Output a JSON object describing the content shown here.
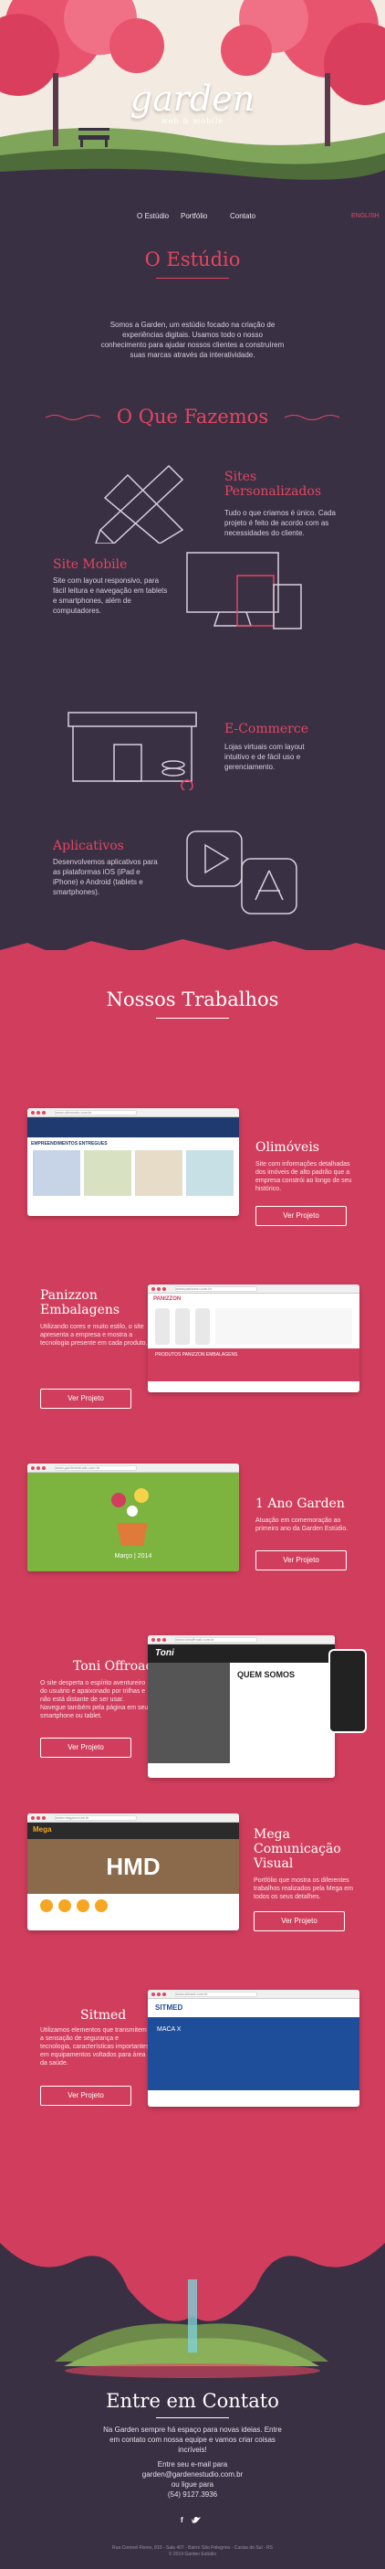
{
  "hero": {
    "logo": "garden",
    "tagline": "web & mobile"
  },
  "nav": {
    "items": [
      "O Estúdio",
      "Portfólio",
      "Contato"
    ],
    "lang": "ENGLISH"
  },
  "studio": {
    "title": "O Estúdio",
    "text": "Somos a Garden, um estúdio focado na criação de experiências digitais. Usamos todo o nosso conhecimento para ajudar nossos clientes a construírem suas marcas através da interatividade."
  },
  "services": {
    "title": "O Que Fazemos",
    "items": [
      {
        "title": "Sites Personalizados",
        "text": "Tudo o que criamos é único. Cada projeto é feito de acordo com as necessidades do cliente."
      },
      {
        "title": "Site Mobile",
        "text": "Site com layout responsivo, para fácil leitura e navegação em tablets e smartphones, além de computadores."
      },
      {
        "title": "E-Commerce",
        "text": "Lojas virtuais com layout intuitivo e de fácil uso e gerenciamento."
      },
      {
        "title": "Aplicativos",
        "text": "Desenvolvemos aplicativos para as plataformas iOS (iPad e iPhone) e Android (tablets e smartphones)."
      }
    ]
  },
  "works": {
    "title": "Nossos Trabalhos",
    "button_label": "Ver Projeto",
    "projects": [
      {
        "title": "Olimóveis",
        "text": "Site com informações detalhadas dos imóveis de alto padrão que a empresa constrói ao longo de seu histórico.",
        "url": "www.olimoveis.com.br"
      },
      {
        "title": "Panizzon Embalagens",
        "text": "Utilizando cores e muito estilo, o site apresenta a empresa e mostra a tecnologia presente em cada produto.",
        "url": "www.panizzon.com.br"
      },
      {
        "title": "1 Ano Garden",
        "text": "Atuação em comemoração ao primeiro ano da Garden Estúdio.",
        "url": "www.gardenestudio.com.br"
      },
      {
        "title": "Toni Offroad",
        "text": "O site desperta o espírito aventureiro do usuário e apaixonado por trilhas e não está distante de ser usar. Navegue também pela página em seu smartphone ou tablet.",
        "url": "www.tonioffroad.com.br"
      },
      {
        "title": "Mega Comunicação Visual",
        "text": "Portfólio que mostra os diferentes trabalhos realizados pela Mega em todos os seus detalhes.",
        "url": "www.megacv.com.br"
      },
      {
        "title": "Sitmed",
        "text": "Utilizamos elementos que transmitem a sensação de segurança e tecnologia, características importantes em equipamentos voltados para área da saúde.",
        "url": "www.sitmed.com.br"
      }
    ],
    "mock": {
      "olimoveis_heading": "EMPREENDIMENTOS ENTREGUES",
      "panizzon_brand": "PANIZZON",
      "panizzon_sub": "PRODUTOS PANIZZON EMBALAGENS",
      "garden_date": "Março | 2014",
      "toni_brand": "Toni",
      "toni_heading": "QUEM SOMOS",
      "mega_brand": "Mega",
      "mega_sign": "HMD",
      "sitmed_brand": "SITMED",
      "sitmed_product": "MACA X"
    }
  },
  "contact": {
    "title": "Entre em Contato",
    "intro": "Na Garden sempre há espaço para novas ideias. Entre em contato com nossa equipe e vamos criar coisas incríveis!",
    "email_prompt": "Entre seu e-mail para",
    "email": "garden@gardenestudio.com.br",
    "phone_prompt": "ou ligue para",
    "phone": "(54) 9127.3936"
  },
  "footer": {
    "line1": "Rua Coronel Flores, 810 - Sala 407 - Bairro São Pelegrino - Caxias do Sul - RS",
    "line2": "© 2014 Garden Estúdio"
  },
  "colors": {
    "accent": "#e3465f",
    "dark": "#3a3044",
    "works_bg": "#d13e5d"
  }
}
